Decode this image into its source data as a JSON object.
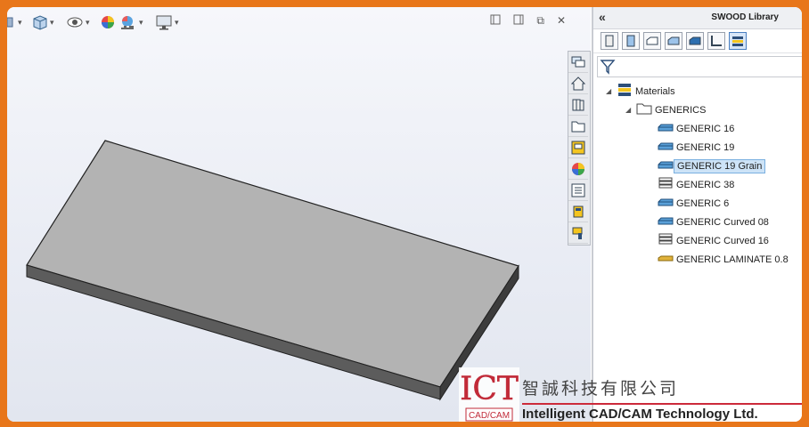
{
  "panel": {
    "title": "SWOOD Library",
    "collapse_glyph": "«",
    "filter_placeholder": ""
  },
  "window": {
    "restore": "⧉",
    "close": "✕"
  },
  "tree": {
    "root": "Materials",
    "folder": "GENERICS",
    "items": [
      {
        "label": "GENERIC 16",
        "icon": "panel-material-icon",
        "selected": false
      },
      {
        "label": "GENERIC 19",
        "icon": "panel-material-icon",
        "selected": false
      },
      {
        "label": "GENERIC 19 Grain",
        "icon": "panel-material-icon",
        "selected": true
      },
      {
        "label": "GENERIC 38",
        "icon": "stacked-material-icon",
        "selected": false
      },
      {
        "label": "GENERIC 6",
        "icon": "panel-material-icon",
        "selected": false
      },
      {
        "label": "GENERIC Curved 08",
        "icon": "panel-material-icon",
        "selected": false
      },
      {
        "label": "GENERIC Curved 16",
        "icon": "stacked-material-icon",
        "selected": false
      },
      {
        "label": "GENERIC LAMINATE 0.8",
        "icon": "laminate-material-icon",
        "selected": false
      }
    ]
  },
  "watermark": {
    "logo_text": "ICT",
    "logo_sub": "CAD/CAM",
    "company_cn": "智誠科技有限公司",
    "company_en": "Intelligent CAD/CAM Technology Ltd."
  },
  "colors": {
    "frame": "#e8761a",
    "accent": "#cc2a3a",
    "selection": "#cde3f7"
  }
}
